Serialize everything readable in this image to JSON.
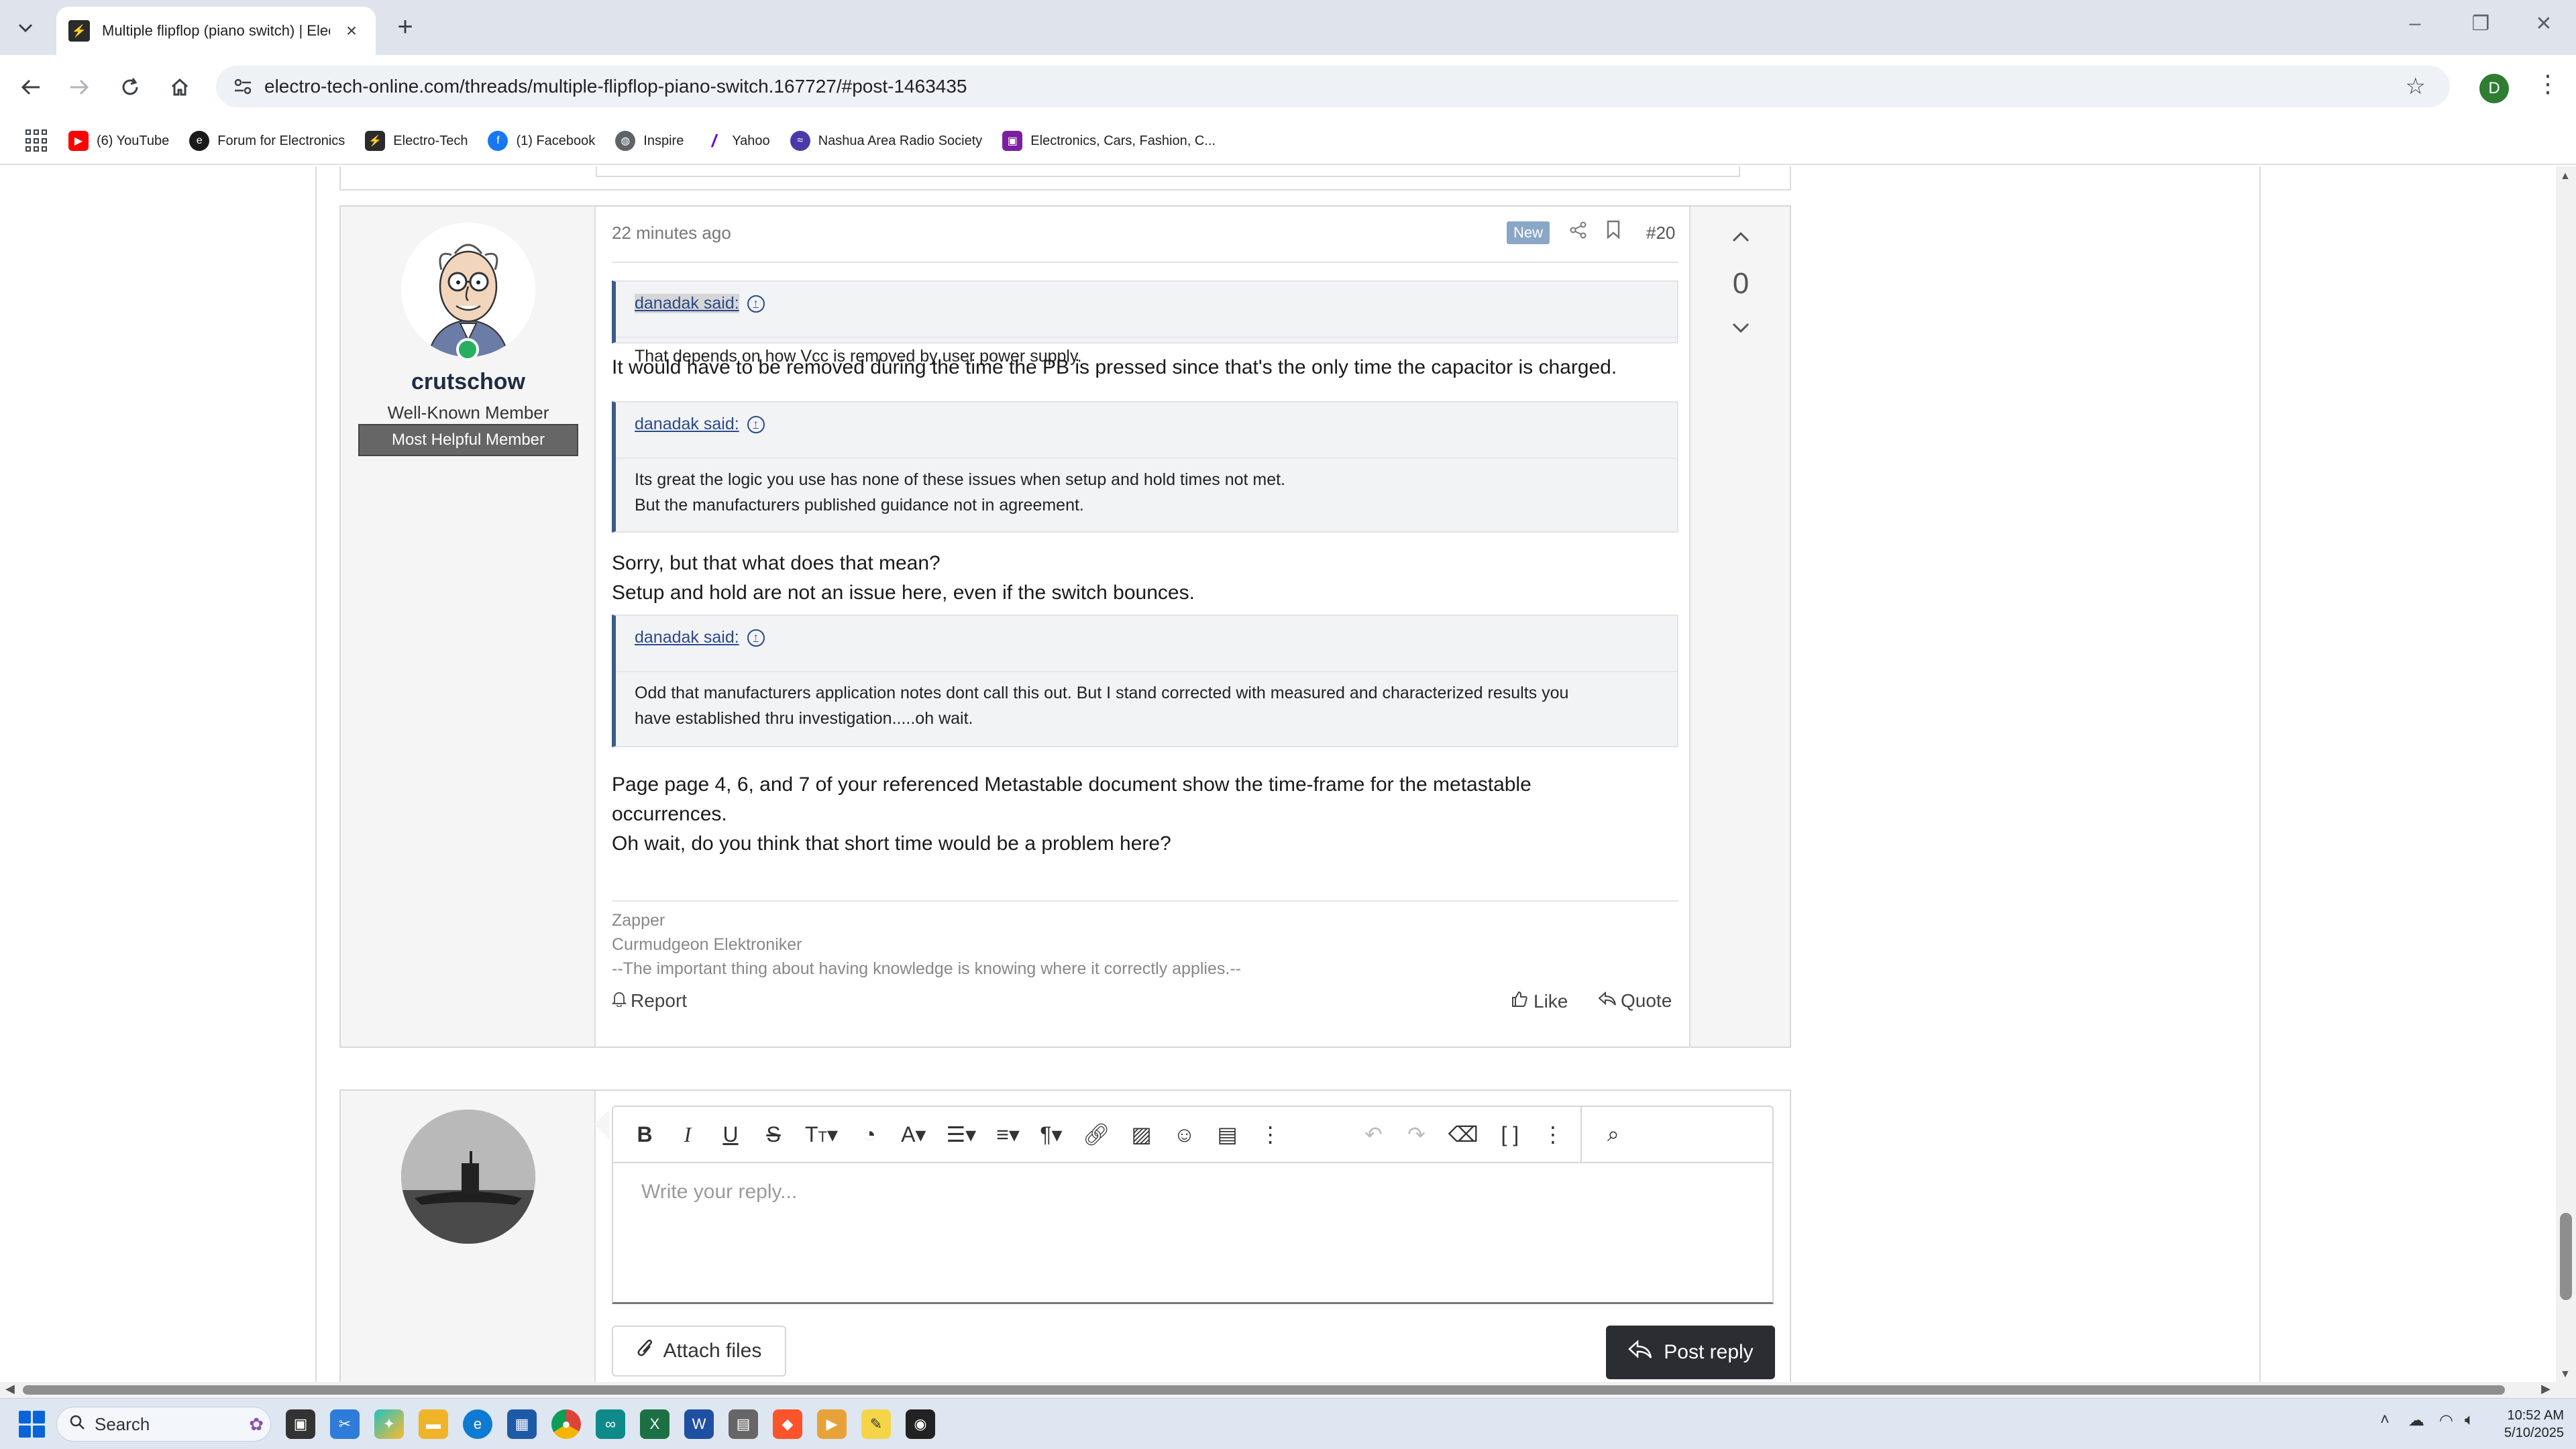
{
  "browser": {
    "tab_title": "Multiple flipflop (piano switch) | Electronic",
    "url": "electro-tech-online.com/threads/multiple-flipflop-piano-switch.167727/#post-1463435",
    "profile_initial": "D",
    "bookmarks": [
      {
        "label": "(6) YouTube",
        "icon": "youtube-icon",
        "color": "#ff0000"
      },
      {
        "label": "Forum for Electronics",
        "icon": "edaboard-icon",
        "color": "#1a1a1a"
      },
      {
        "label": "Electro-Tech",
        "icon": "electro-tech-icon",
        "color": "#2b2b2b"
      },
      {
        "label": "(1) Facebook",
        "icon": "facebook-icon",
        "color": "#1877f2"
      },
      {
        "label": "Inspire",
        "icon": "globe-icon",
        "color": "#5f6368"
      },
      {
        "label": "Yahoo",
        "icon": "yahoo-icon",
        "color": "#6001d2"
      },
      {
        "label": "Nashua Area Radio Society",
        "icon": "radio-society-icon",
        "color": "#4a3aa8"
      },
      {
        "label": "Electronics, Cars, Fashion, C...",
        "icon": "shopping-bag-icon",
        "color": "#7b1fa2"
      }
    ]
  },
  "post": {
    "author": "crutschow",
    "user_title": "Well-Known Member",
    "user_banner": "Most Helpful Member",
    "time": "22 minutes ago",
    "new_label": "New",
    "number": "#20",
    "vote_count": "0",
    "quotes": [
      {
        "author": "danadak said:",
        "lines": [
          "That depends on how Vcc is removed by user power supply."
        ]
      },
      {
        "author": "danadak said:",
        "lines": [
          "Its great the logic you use has none of these issues when setup and hold times not met.",
          "But the manufacturers published guidance not in agreement."
        ]
      },
      {
        "author": "danadak said:",
        "lines": [
          "Odd that manufacturers application notes dont call this out. But I stand corrected with measured and characterized results you",
          "have established thru investigation.....oh wait."
        ]
      }
    ],
    "replies": [
      [
        "It would have to be removed during the time the PB is pressed since that's the only time the capacitor is charged."
      ],
      [
        "Sorry, but that what does that mean?",
        "Setup and hold are not an issue here, even if the switch bounces."
      ],
      [
        "Page page 4, 6, and 7 of your referenced Metastable document show the time-frame for the metastable",
        "occurrences.",
        "Oh wait, do you think that short time would be a problem here?"
      ]
    ],
    "signature": [
      "Zapper",
      "Curmudgeon Elektroniker",
      "--The important thing about having knowledge is knowing where it correctly applies.--"
    ],
    "report_label": "Report",
    "like_label": "Like",
    "quote_label": "Quote"
  },
  "reply_box": {
    "placeholder": "Write your reply...",
    "attach_label": "Attach files",
    "post_label": "Post reply"
  },
  "taskbar": {
    "search_label": "Search",
    "time": "10:52 AM",
    "date": "5/10/2025"
  }
}
